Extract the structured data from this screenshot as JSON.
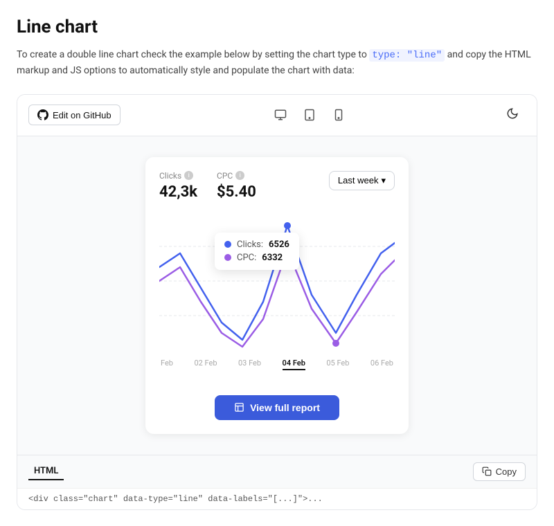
{
  "page": {
    "title": "Line chart",
    "description_prefix": "To create a double line chart check the example below by setting the chart type to ",
    "code_keyword": "type: \"line\"",
    "description_suffix": " and copy the HTML markup and JS options to automatically style and populate the chart with data:"
  },
  "toolbar": {
    "edit_github_label": "Edit on GitHub",
    "dark_mode_icon": "🌙"
  },
  "chart": {
    "clicks_label": "Clicks",
    "cpc_label": "CPC",
    "clicks_value": "42,3k",
    "cpc_value": "$5.40",
    "period_label": "Last week",
    "tooltip": {
      "clicks_label": "Clicks:",
      "clicks_value": "6526",
      "cpc_label": "CPC:",
      "cpc_value": "6332"
    },
    "x_labels": [
      "Feb",
      "02 Feb",
      "03 Feb",
      "04 Feb",
      "05 Feb",
      "06 Feb"
    ],
    "active_x": "04 Feb",
    "clicks_color": "#4361ee",
    "cpc_color": "#9b5de5"
  },
  "buttons": {
    "view_report": "View full report",
    "copy": "Copy"
  },
  "code_tabs": {
    "html_label": "HTML"
  },
  "code_preview": "<div class=\"chart\" data-type=\"line\" data-labels=\"[...]\">..."
}
